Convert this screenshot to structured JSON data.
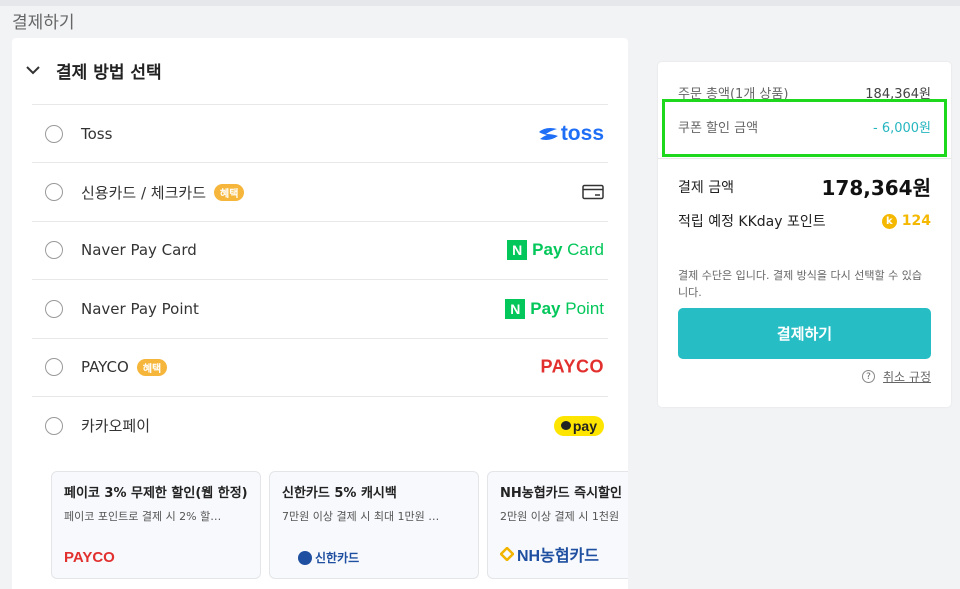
{
  "page": {
    "title": "결제하기"
  },
  "payment_section": {
    "title": "결제 방법 선택",
    "methods": [
      {
        "label": "Toss",
        "logo_text": "toss",
        "badge": ""
      },
      {
        "label": "신용카드 / 체크카드",
        "badge": "혜택"
      },
      {
        "label": "Naver Pay Card",
        "logo_n": "N",
        "logo_pay": "Pay",
        "logo_suffix": "Card"
      },
      {
        "label": "Naver Pay Point",
        "logo_n": "N",
        "logo_pay": "Pay",
        "logo_suffix": "Point"
      },
      {
        "label": "PAYCO",
        "badge": "혜택",
        "logo_text": "PAYCO"
      },
      {
        "label": "카카오페이",
        "logo_text": "pay"
      }
    ],
    "promos": [
      {
        "title": "페이코 3% 무제한 할인(웹 한정)",
        "desc": "페이코 포인트로 결제 시 2% 할…",
        "logo": "PAYCO"
      },
      {
        "title": "신한카드 5% 캐시백",
        "desc": "7만원 이상 결제 시 최대 1만원 …",
        "logo": "신한카드"
      },
      {
        "title": "NH농협카드 즉시할인",
        "desc": "2만원 이상 결제 시 1천원",
        "logo": "NH농협카드"
      }
    ]
  },
  "summary": {
    "order_total_label": "주문 총액(1개 상품)",
    "order_total_value": "184,364원",
    "coupon_label": "쿠폰 할인 금액",
    "coupon_value": "- 6,000원",
    "payment_amount_label": "결제 금액",
    "payment_amount_value": "178,364원",
    "points_label": "적립 예정 KKday 포인트",
    "points_coin": "k",
    "points_value": "124",
    "note": "결제 수단은 입니다. 결제 방식을 다시 선택할 수 있습니다.",
    "pay_button_label": "결제하기",
    "help_glyph": "?",
    "cancel_policy_label": "취소 규정"
  },
  "colors": {
    "accent": "#26bec4",
    "coupon": "#26b6c0",
    "highlight": "#1ed81e",
    "points": "#f5b800",
    "badge": "#f5b63b"
  }
}
